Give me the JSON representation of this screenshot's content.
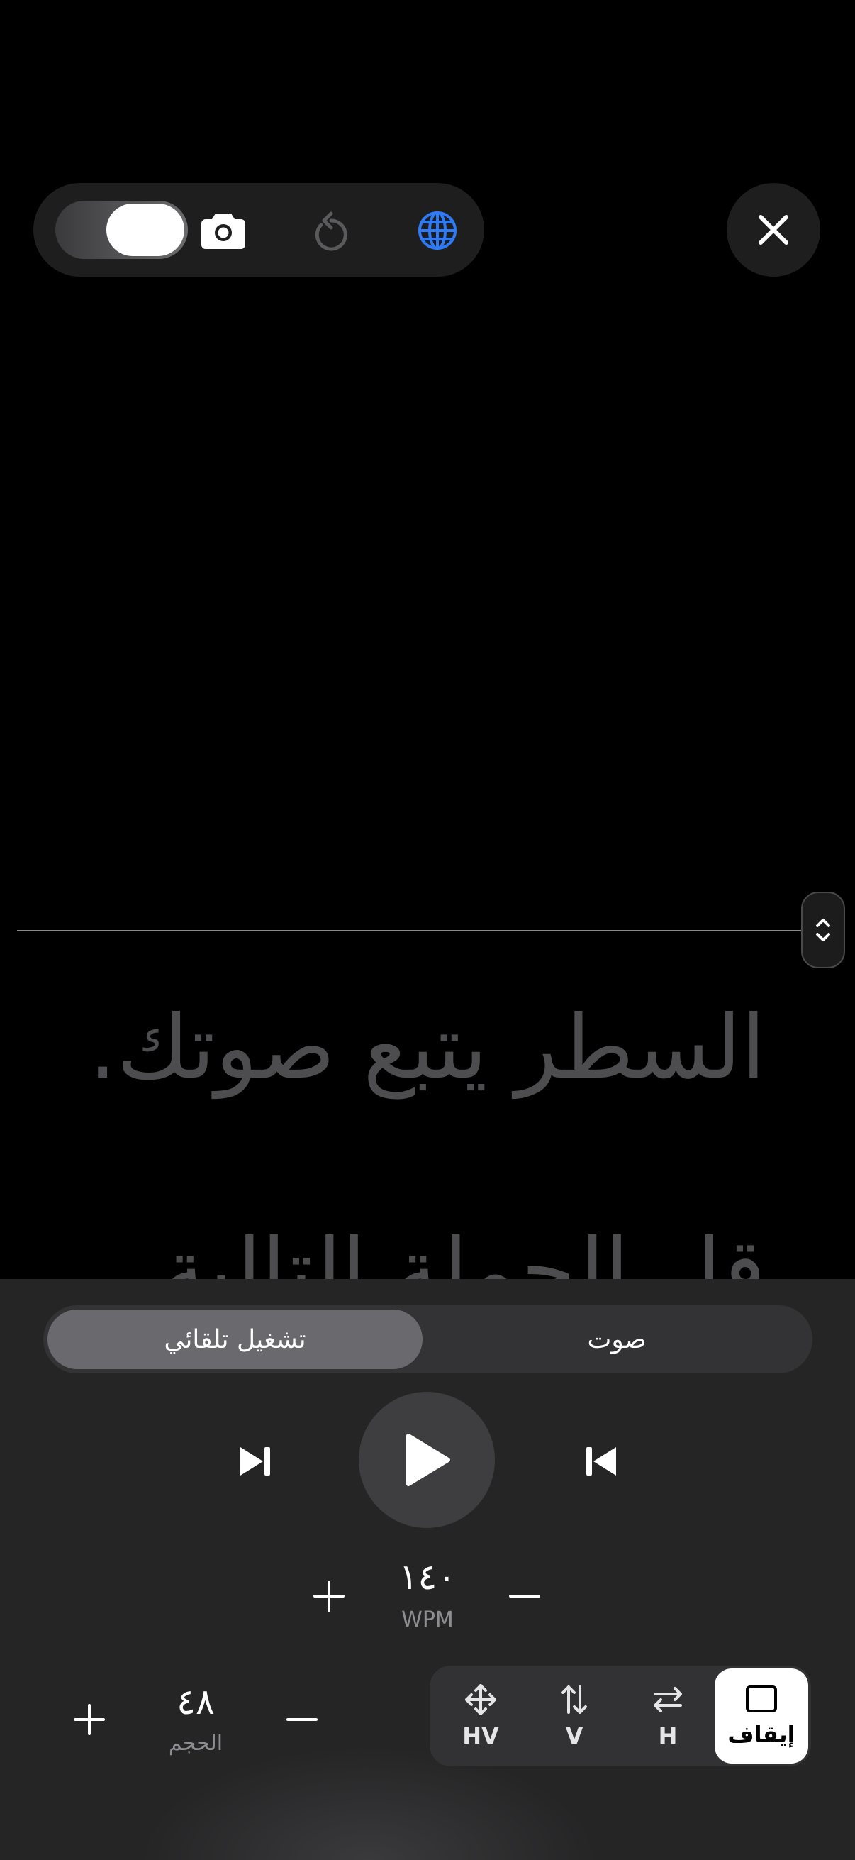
{
  "toolbar": {
    "toggle_state": "on",
    "icons": [
      "camera-icon",
      "undo-icon",
      "globe-icon"
    ],
    "globe_color": "#2f7bf6",
    "close_icon": "close-icon"
  },
  "guide": {
    "handle_icon": "chevron-up-down-icon"
  },
  "script": {
    "line1": "السطر يتبع صوتك.",
    "line2": "قل الجملة التالية"
  },
  "panel": {
    "segments": {
      "active": "تشغيل تلقائي",
      "inactive": "صوت"
    },
    "transport": {
      "next_icon": "skip-forward-icon",
      "play_icon": "play-icon",
      "prev_icon": "skip-back-icon"
    },
    "speed": {
      "value": "١٤٠",
      "unit": "WPM"
    },
    "size": {
      "value": "٤٨",
      "label": "الحجم"
    },
    "modes": [
      {
        "label": "HV",
        "icon": "move-icon"
      },
      {
        "label": "V",
        "icon": "arrows-vertical-icon"
      },
      {
        "label": "H",
        "icon": "arrows-horizontal-icon"
      },
      {
        "label": "إيقاف",
        "icon": "square-icon"
      }
    ],
    "active_mode": "إيقاف"
  }
}
